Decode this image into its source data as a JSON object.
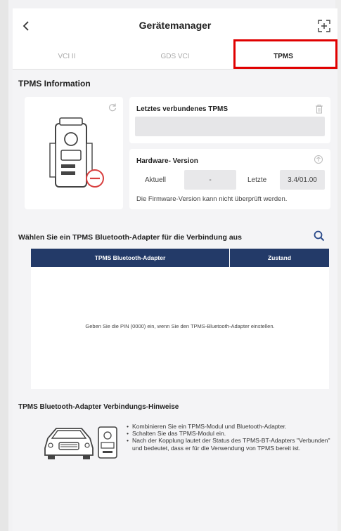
{
  "header": {
    "title": "Gerätemanager",
    "back_icon": "chevron-left-icon",
    "right_icon": "expand-icon"
  },
  "tabs": [
    {
      "label": "VCI II",
      "active": false
    },
    {
      "label": "GDS VCI",
      "active": false
    },
    {
      "label": "TPMS",
      "active": true
    }
  ],
  "info": {
    "heading": "TPMS Information",
    "last_connected_label": "Letztes verbundenes TPMS",
    "last_connected_value": "",
    "hardware_label": "Hardware- Version",
    "current_label": "Aktuell",
    "current_value": "-",
    "latest_label": "Letzte",
    "latest_value": "3.4/01.00",
    "firmware_note": "Die Firmware-Version kann nicht überprüft werden."
  },
  "adapters": {
    "heading": "Wählen Sie ein TPMS Bluetooth-Adapter für die Verbindung aus",
    "col_adapter": "TPMS Bluetooth-Adapter",
    "col_state": "Zustand",
    "empty_message": "Geben Sie die PIN (0000) ein, wenn Sie den TPMS-Bluetooth-Adapter einstellen."
  },
  "hints": {
    "heading": "TPMS Bluetooth-Adapter Verbindungs-Hinweise",
    "items": [
      "Kombinieren Sie ein TPMS-Modul und Bluetooth-Adapter.",
      "Schalten Sie das TPMS-Modul ein.",
      "Nach der Kopplung lautet der Status des TPMS-BT-Adapters \"Verbunden\" und bedeutet, dass er für die Verwendung von TPMS bereit ist."
    ]
  },
  "colors": {
    "table_header": "#233a68",
    "highlight": "#e00000",
    "accent_icon": "#2a4a8a"
  }
}
